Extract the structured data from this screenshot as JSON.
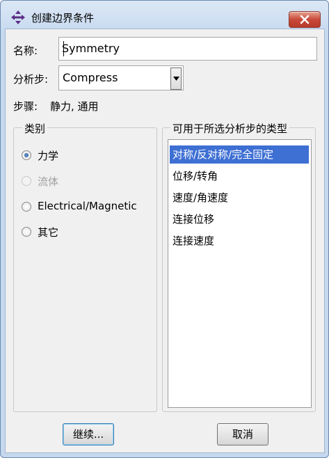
{
  "window": {
    "title": "创建边界条件",
    "title_icon": "move-arrows-icon",
    "close_icon": "close-icon"
  },
  "form": {
    "name_label": "名称:",
    "name_value": "Symmetry",
    "step_label": "分析步:",
    "step_value": "Compress",
    "procedure_label": "步骤:",
    "procedure_value": "静力, 通用"
  },
  "category": {
    "title": "类别",
    "options": [
      {
        "label": "力学",
        "checked": true,
        "enabled": true
      },
      {
        "label": "流体",
        "checked": false,
        "enabled": false
      },
      {
        "label": "Electrical/Magnetic",
        "checked": false,
        "enabled": true
      },
      {
        "label": "其它",
        "checked": false,
        "enabled": true
      }
    ]
  },
  "types": {
    "title": "可用于所选分析步的类型",
    "items": [
      {
        "label": "对称/反对称/完全固定",
        "selected": true
      },
      {
        "label": "位移/转角",
        "selected": false
      },
      {
        "label": "速度/角速度",
        "selected": false
      },
      {
        "label": "连接位移",
        "selected": false
      },
      {
        "label": "连接速度",
        "selected": false
      }
    ]
  },
  "buttons": {
    "continue": "继续...",
    "cancel": "取消"
  },
  "colors": {
    "selection": "#3e6fd3",
    "close_button": "#c94a3a"
  }
}
